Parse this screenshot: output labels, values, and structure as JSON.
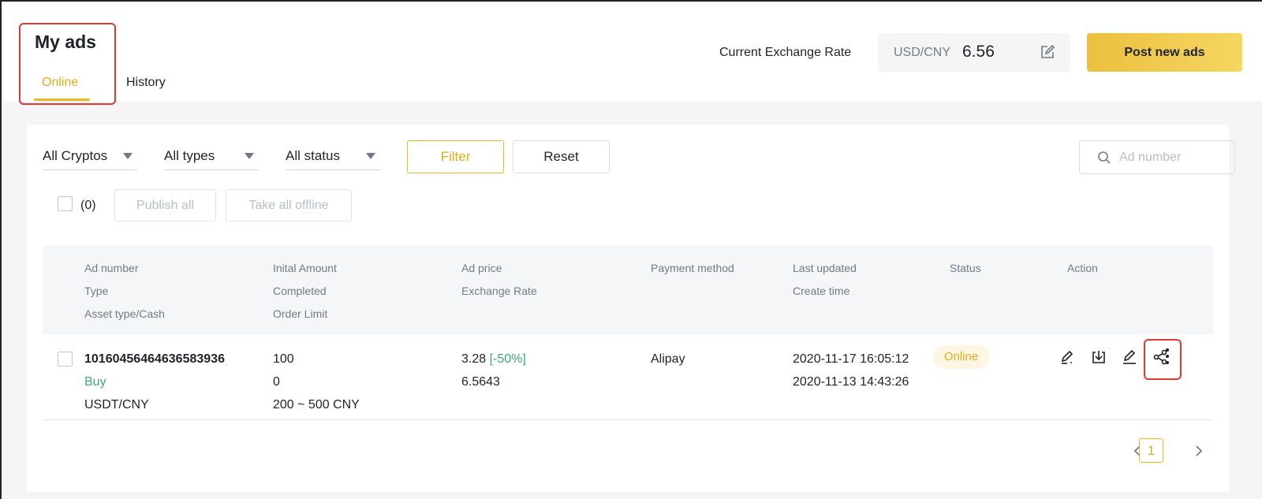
{
  "header": {
    "title": "My ads",
    "tabs": [
      {
        "label": "Online",
        "active": true
      },
      {
        "label": "History",
        "active": false
      }
    ],
    "exchange_rate_label": "Current Exchange Rate",
    "exchange_pair": "USD/CNY",
    "exchange_value": "6.56",
    "post_button": "Post new ads"
  },
  "filters": {
    "crypto": "All Cryptos",
    "type": "All types",
    "status": "All status",
    "filter_button": "Filter",
    "reset_button": "Reset",
    "search_placeholder": "Ad number"
  },
  "bulk": {
    "selected_count": "(0)",
    "publish_all": "Publish all",
    "take_all_offline": "Take all offline"
  },
  "table": {
    "headers": {
      "col1": [
        "Ad number",
        "Type",
        "Asset type/Cash"
      ],
      "col2": [
        "Inital Amount",
        "Completed",
        "Order Limit"
      ],
      "col3": [
        "Ad price",
        "Exchange Rate"
      ],
      "col4": [
        "Payment method"
      ],
      "col5": [
        "Last updated",
        "Create time"
      ],
      "col6": [
        "Status"
      ],
      "col7": [
        "Action"
      ]
    },
    "rows": [
      {
        "ad_number": "10160456464636583936",
        "type": "Buy",
        "asset": "USDT/CNY",
        "initial_amount": "100",
        "completed": "0",
        "order_limit": "200 ~ 500 CNY",
        "ad_price": "3.28",
        "price_delta": "[-50%]",
        "exchange_rate": "6.5643",
        "payment_method": "Alipay",
        "last_updated": "2020-11-17 16:05:12",
        "create_time": "2020-11-13 14:43:26",
        "status": "Online"
      }
    ]
  },
  "pagination": {
    "current_page": "1"
  },
  "colors": {
    "accent": "#e8b825",
    "buy_green": "#3ba77b",
    "annotation_red": "#e03a2f"
  },
  "icons": [
    "edit-rate-icon",
    "search-icon",
    "edit-pen-icon",
    "download-icon",
    "pencil-icon",
    "share-icon",
    "more-vertical-icon",
    "chevron-left-icon",
    "chevron-right-icon"
  ]
}
